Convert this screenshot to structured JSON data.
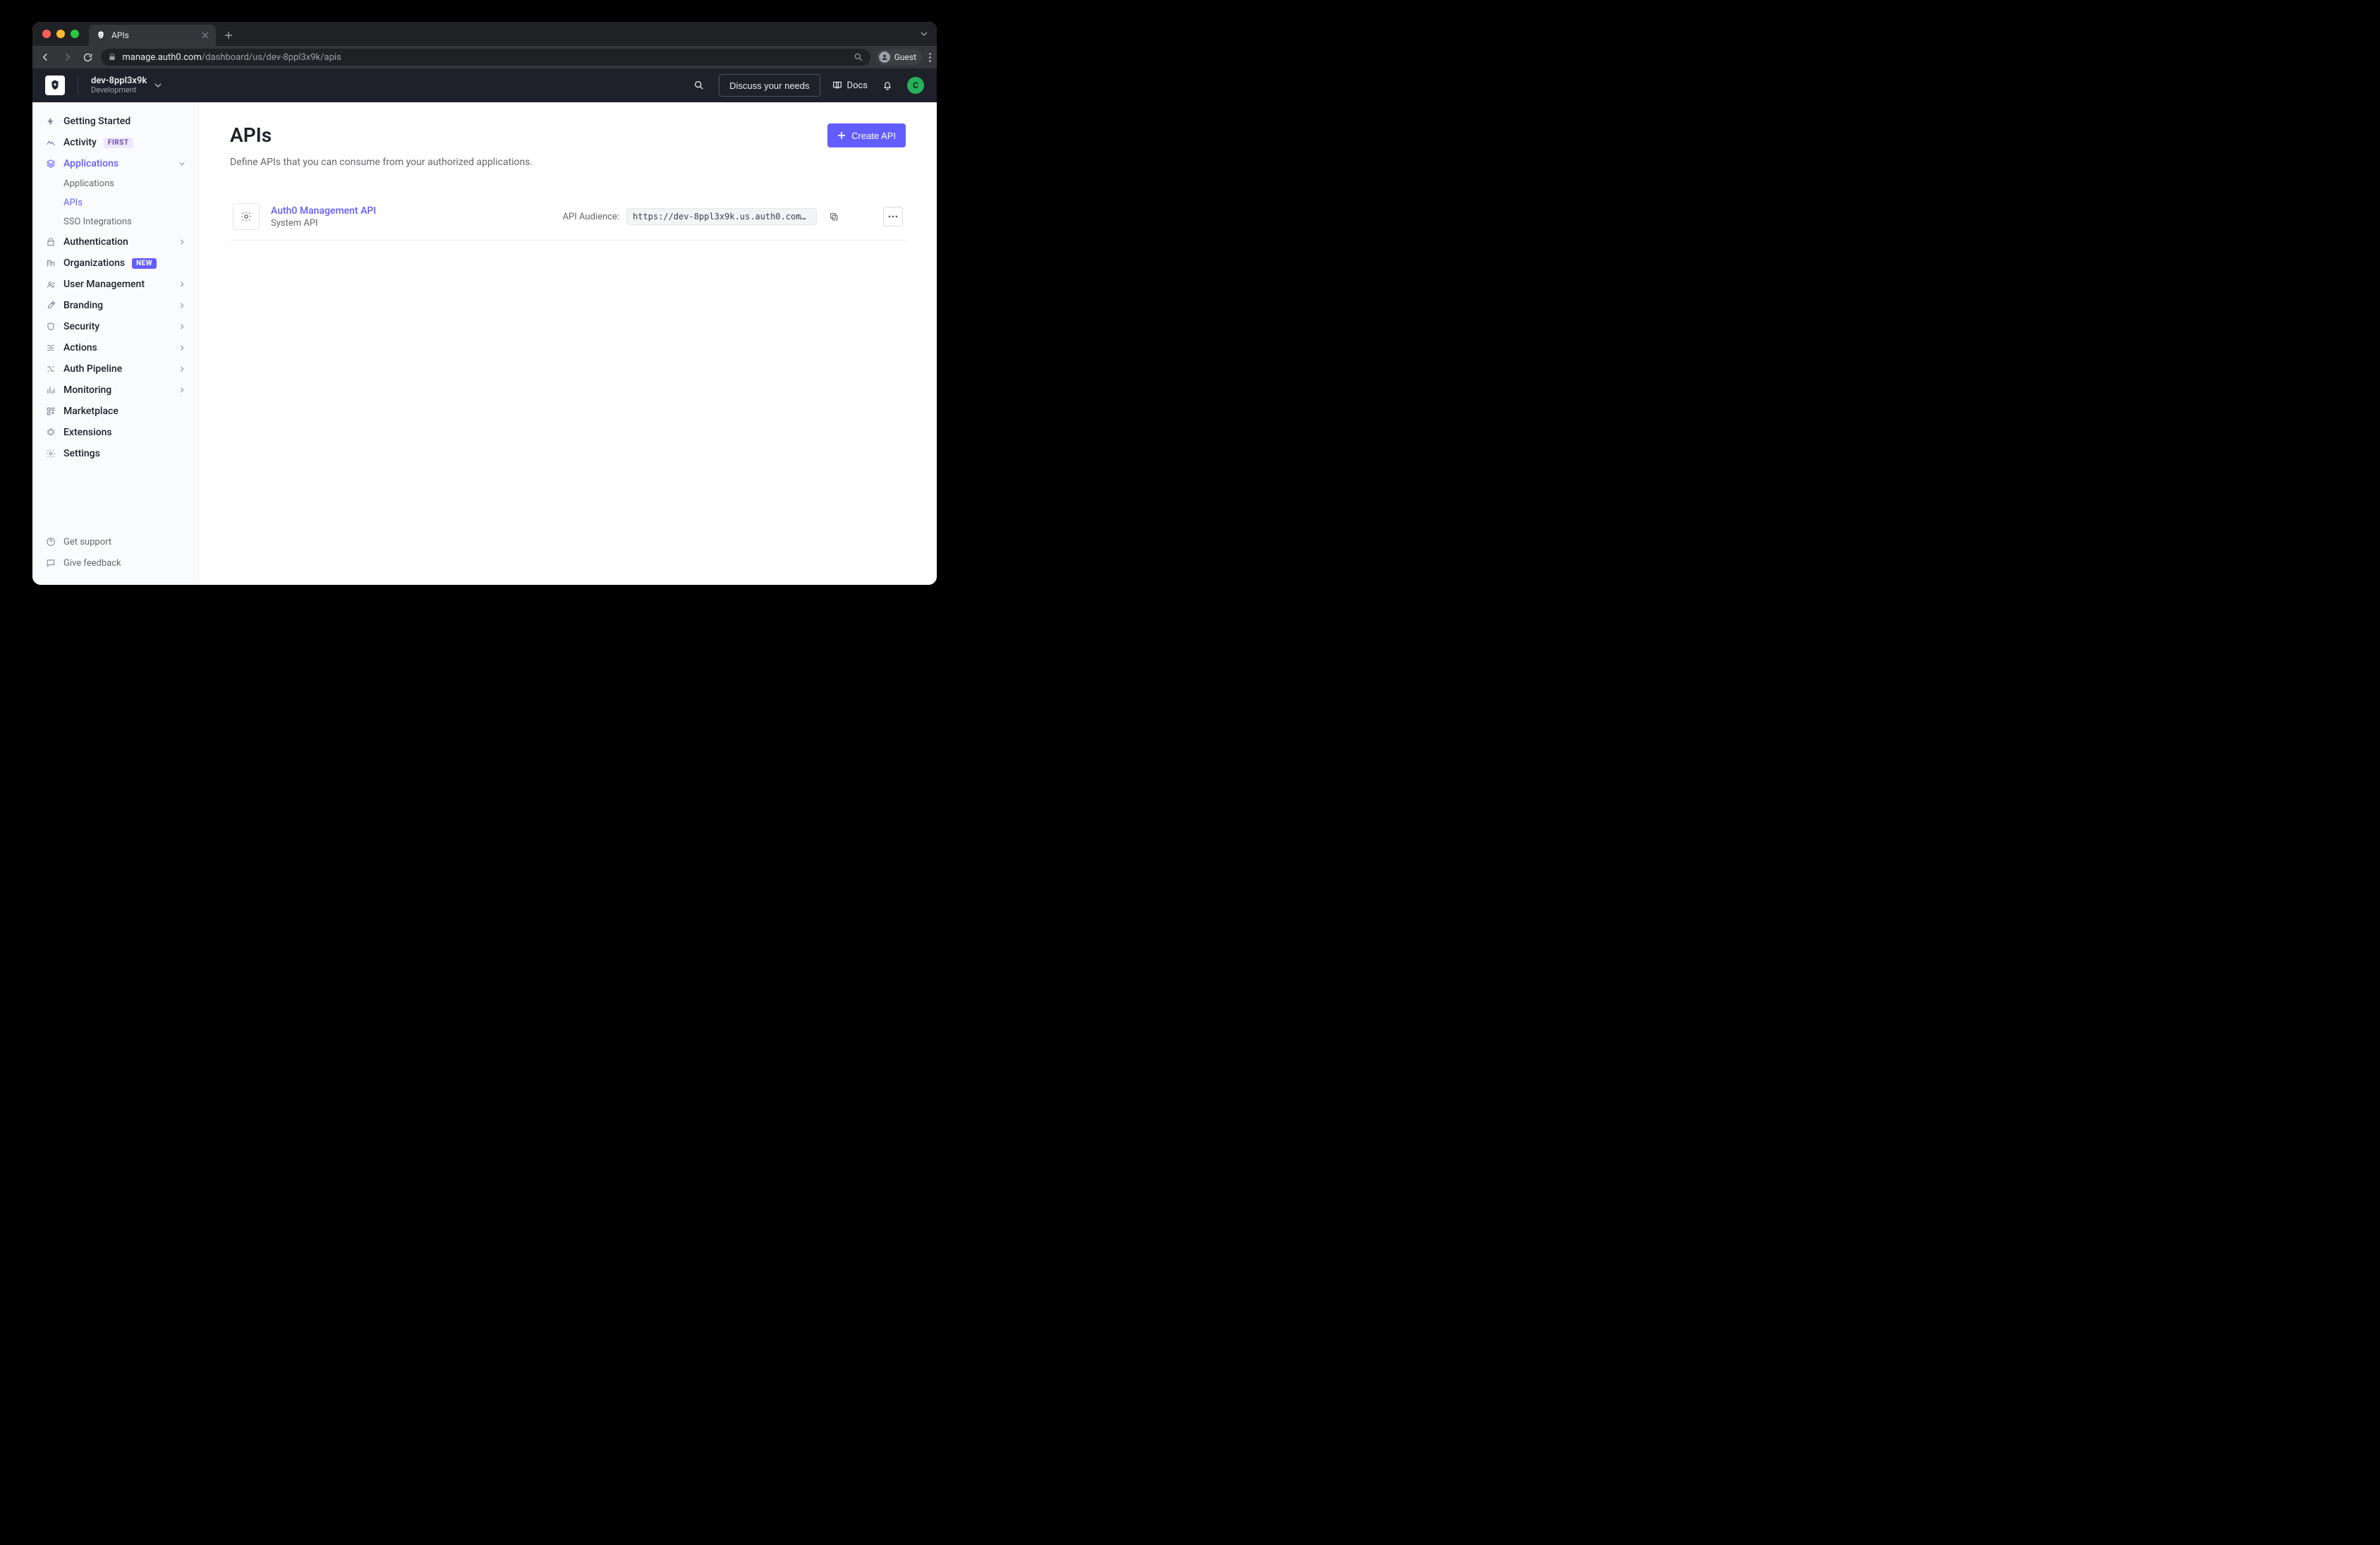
{
  "browser": {
    "tab_title": "APIs",
    "url_domain": "manage.auth0.com",
    "url_path": "/dashboard/us/dev-8ppl3x9k/apis",
    "profile": "Guest"
  },
  "header": {
    "tenant_name": "dev-8ppl3x9k",
    "tenant_env": "Development",
    "discuss": "Discuss your needs",
    "docs": "Docs",
    "avatar_letter": "C"
  },
  "sidebar": {
    "items": [
      {
        "label": "Getting Started",
        "badge": null,
        "expandable": false
      },
      {
        "label": "Activity",
        "badge": "FIRST",
        "expandable": false
      },
      {
        "label": "Applications",
        "badge": null,
        "expandable": true,
        "active": true,
        "children": [
          {
            "label": "Applications",
            "active": false
          },
          {
            "label": "APIs",
            "active": true
          },
          {
            "label": "SSO Integrations",
            "active": false
          }
        ]
      },
      {
        "label": "Authentication",
        "badge": null,
        "expandable": true
      },
      {
        "label": "Organizations",
        "badge": "NEW",
        "expandable": false
      },
      {
        "label": "User Management",
        "badge": null,
        "expandable": true
      },
      {
        "label": "Branding",
        "badge": null,
        "expandable": true
      },
      {
        "label": "Security",
        "badge": null,
        "expandable": true
      },
      {
        "label": "Actions",
        "badge": null,
        "expandable": true
      },
      {
        "label": "Auth Pipeline",
        "badge": null,
        "expandable": true
      },
      {
        "label": "Monitoring",
        "badge": null,
        "expandable": true
      },
      {
        "label": "Marketplace",
        "badge": null,
        "expandable": false
      },
      {
        "label": "Extensions",
        "badge": null,
        "expandable": false
      },
      {
        "label": "Settings",
        "badge": null,
        "expandable": false
      }
    ],
    "footer": {
      "support": "Get support",
      "feedback": "Give feedback"
    }
  },
  "main": {
    "title": "APIs",
    "description": "Define APIs that you can consume from your authorized applications.",
    "create_button": "Create API",
    "audience_label": "API Audience:",
    "rows": [
      {
        "name": "Auth0 Management API",
        "subtitle": "System API",
        "audience": "https://dev-8ppl3x9k.us.auth0.com/api…"
      }
    ]
  }
}
